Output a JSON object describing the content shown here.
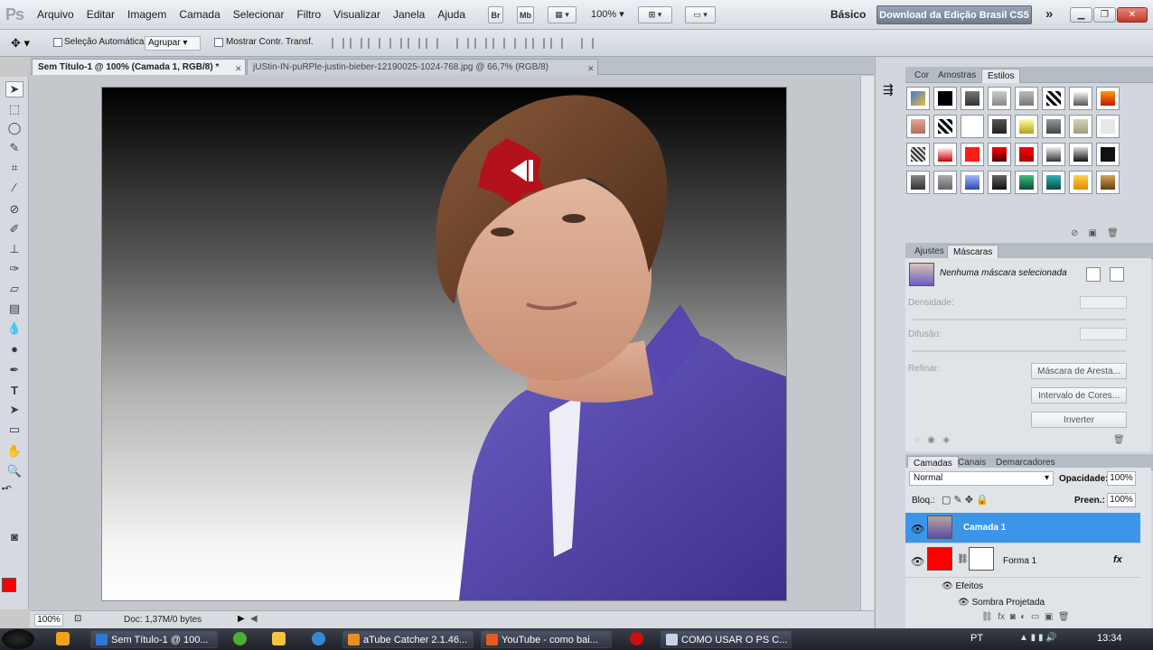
{
  "app": {
    "menu": [
      "Arquivo",
      "Editar",
      "Imagem",
      "Camada",
      "Selecionar",
      "Filtro",
      "Visualizar",
      "Janela",
      "Ajuda"
    ],
    "bridge_label": "Br",
    "minibridge_label": "Mb",
    "zoom": "100%",
    "workspace": "Básico",
    "download_button": "Download da Edição Brasil CS5"
  },
  "options_bar": {
    "auto_select_label": "Seleção Automática:",
    "auto_select_value": "Agrupar",
    "transform_controls_label": "Mostrar Contr. Transf."
  },
  "document_tabs": [
    {
      "label": "Sem Título-1 @ 100% (Camada 1, RGB/8) *",
      "active": true
    },
    {
      "label": "jUStin-IN-puRPle-justin-bieber-12190025-1024-768.jpg @ 66,7% (RGB/8)",
      "active": false
    }
  ],
  "status": {
    "zoom": "100%",
    "doc_info": "Doc: 1,37M/0 bytes"
  },
  "colors": {
    "foreground": "#ff0000",
    "background": "#ffffff",
    "selection": "#3b96ea"
  },
  "styles_panel": {
    "tabs": [
      "Cor",
      "Amostras",
      "Estilos"
    ],
    "active_tab": "Estilos"
  },
  "masks_panel": {
    "tabs": [
      "Ajustes",
      "Máscaras"
    ],
    "active_tab": "Máscaras",
    "no_mask": "Nenhuma máscara selecionada",
    "density_label": "Densidade:",
    "feather_label": "Difusão:",
    "refine_label": "Refinar:",
    "edge_button": "Máscara de Aresta...",
    "color_range_button": "Intervalo de Cores...",
    "invert_button": "Inverter"
  },
  "layers_panel": {
    "tabs": [
      "Camadas",
      "Canais",
      "Demarcadores"
    ],
    "active_tab": "Camadas",
    "blend_mode": "Normal",
    "opacity_label": "Opacidade:",
    "opacity_value": "100%",
    "lock_label": "Bloq.:",
    "fill_label": "Preen.:",
    "fill_value": "100%",
    "layers": [
      {
        "name": "Camada 1",
        "selected": true
      },
      {
        "name": "Forma 1",
        "selected": false,
        "fx": "fx"
      }
    ],
    "effects_label": "Efeitos",
    "drop_shadow_label": "Sombra Projetada"
  },
  "taskbar": {
    "tasks": [
      {
        "label": "Sem Título-1 @ 100..."
      },
      {
        "label": "aTube Catcher 2.1.46..."
      },
      {
        "label": "YouTube - como bai..."
      },
      {
        "label": "COMO USAR O PS C..."
      }
    ],
    "language": "PT",
    "clock": "13:34"
  }
}
